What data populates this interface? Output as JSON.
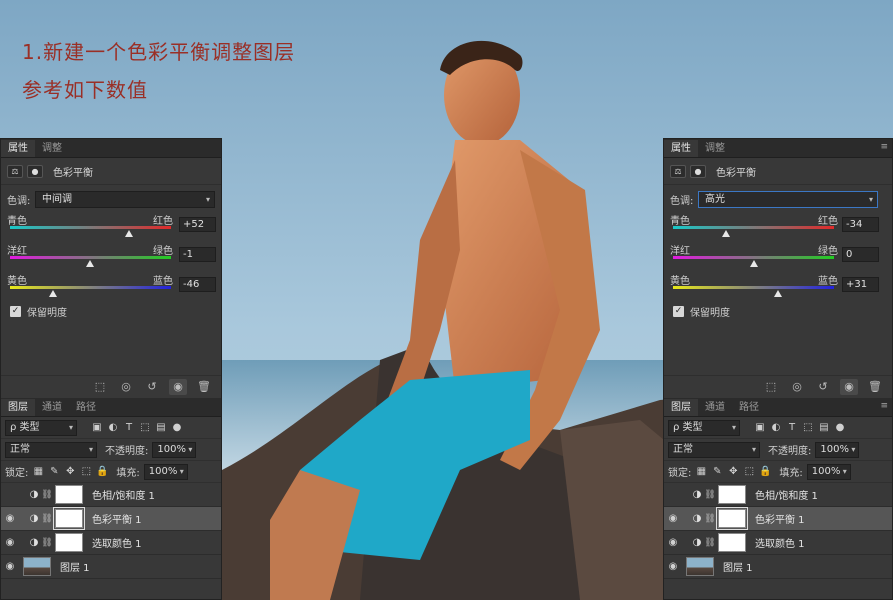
{
  "headline": {
    "line1": "1.新建一个色彩平衡调整图层",
    "line2": "参考如下数值"
  },
  "panels": [
    {
      "tabs": [
        "属性",
        "调整"
      ],
      "title": "色彩平衡",
      "tone_label": "色调:",
      "tone_value": "中间调",
      "sliders": [
        {
          "left": "青色",
          "right": "红色",
          "value": "+52",
          "fraction": 0.74,
          "gradient": [
            "#19c9c9",
            "#e02a2a"
          ]
        },
        {
          "left": "洋红",
          "right": "绿色",
          "value": "-1",
          "fraction": 0.495,
          "gradient": [
            "#e21be0",
            "#22cc22"
          ]
        },
        {
          "left": "黄色",
          "right": "蓝色",
          "value": "-46",
          "fraction": 0.27,
          "gradient": [
            "#e8e81a",
            "#2222dd"
          ]
        }
      ],
      "preserve_label": "保留明度",
      "layers_tabs": [
        "图层",
        "通道",
        "路径"
      ],
      "filter_label": "ρ 类型",
      "blend_mode": "正常",
      "opacity_label": "不透明度:",
      "opacity_value": "100%",
      "lock_label": "锁定:",
      "fill_label": "填充:",
      "fill_value": "100%",
      "layers": [
        {
          "name": "色相/饱和度 1",
          "visible": false,
          "selected": false,
          "kind": "adjustment"
        },
        {
          "name": "色彩平衡 1",
          "visible": true,
          "selected": true,
          "kind": "adjustment"
        },
        {
          "name": "选取颜色 1",
          "visible": true,
          "selected": false,
          "kind": "adjustment"
        },
        {
          "name": "图层 1",
          "visible": true,
          "selected": false,
          "kind": "image"
        }
      ]
    },
    {
      "tabs": [
        "属性",
        "调整"
      ],
      "title": "色彩平衡",
      "tone_label": "色调:",
      "tone_value": "高光",
      "sliders": [
        {
          "left": "青色",
          "right": "红色",
          "value": "-34",
          "fraction": 0.33,
          "gradient": [
            "#19c9c9",
            "#e02a2a"
          ]
        },
        {
          "left": "洋红",
          "right": "绿色",
          "value": "0",
          "fraction": 0.5,
          "gradient": [
            "#e21be0",
            "#22cc22"
          ]
        },
        {
          "left": "黄色",
          "right": "蓝色",
          "value": "+31",
          "fraction": 0.655,
          "gradient": [
            "#e8e81a",
            "#2222dd"
          ]
        }
      ],
      "preserve_label": "保留明度",
      "layers_tabs": [
        "图层",
        "通道",
        "路径"
      ],
      "filter_label": "ρ 类型",
      "blend_mode": "正常",
      "opacity_label": "不透明度:",
      "opacity_value": "100%",
      "lock_label": "锁定:",
      "fill_label": "填充:",
      "fill_value": "100%",
      "layers": [
        {
          "name": "色相/饱和度 1",
          "visible": false,
          "selected": false,
          "kind": "adjustment"
        },
        {
          "name": "色彩平衡 1",
          "visible": true,
          "selected": true,
          "kind": "adjustment"
        },
        {
          "name": "选取颜色 1",
          "visible": true,
          "selected": false,
          "kind": "adjustment"
        },
        {
          "name": "图层 1",
          "visible": true,
          "selected": false,
          "kind": "image"
        }
      ]
    }
  ],
  "colors": {
    "headline": "#9a2f26",
    "panel_bg": "#383838",
    "focus_border": "#3b77c4"
  }
}
